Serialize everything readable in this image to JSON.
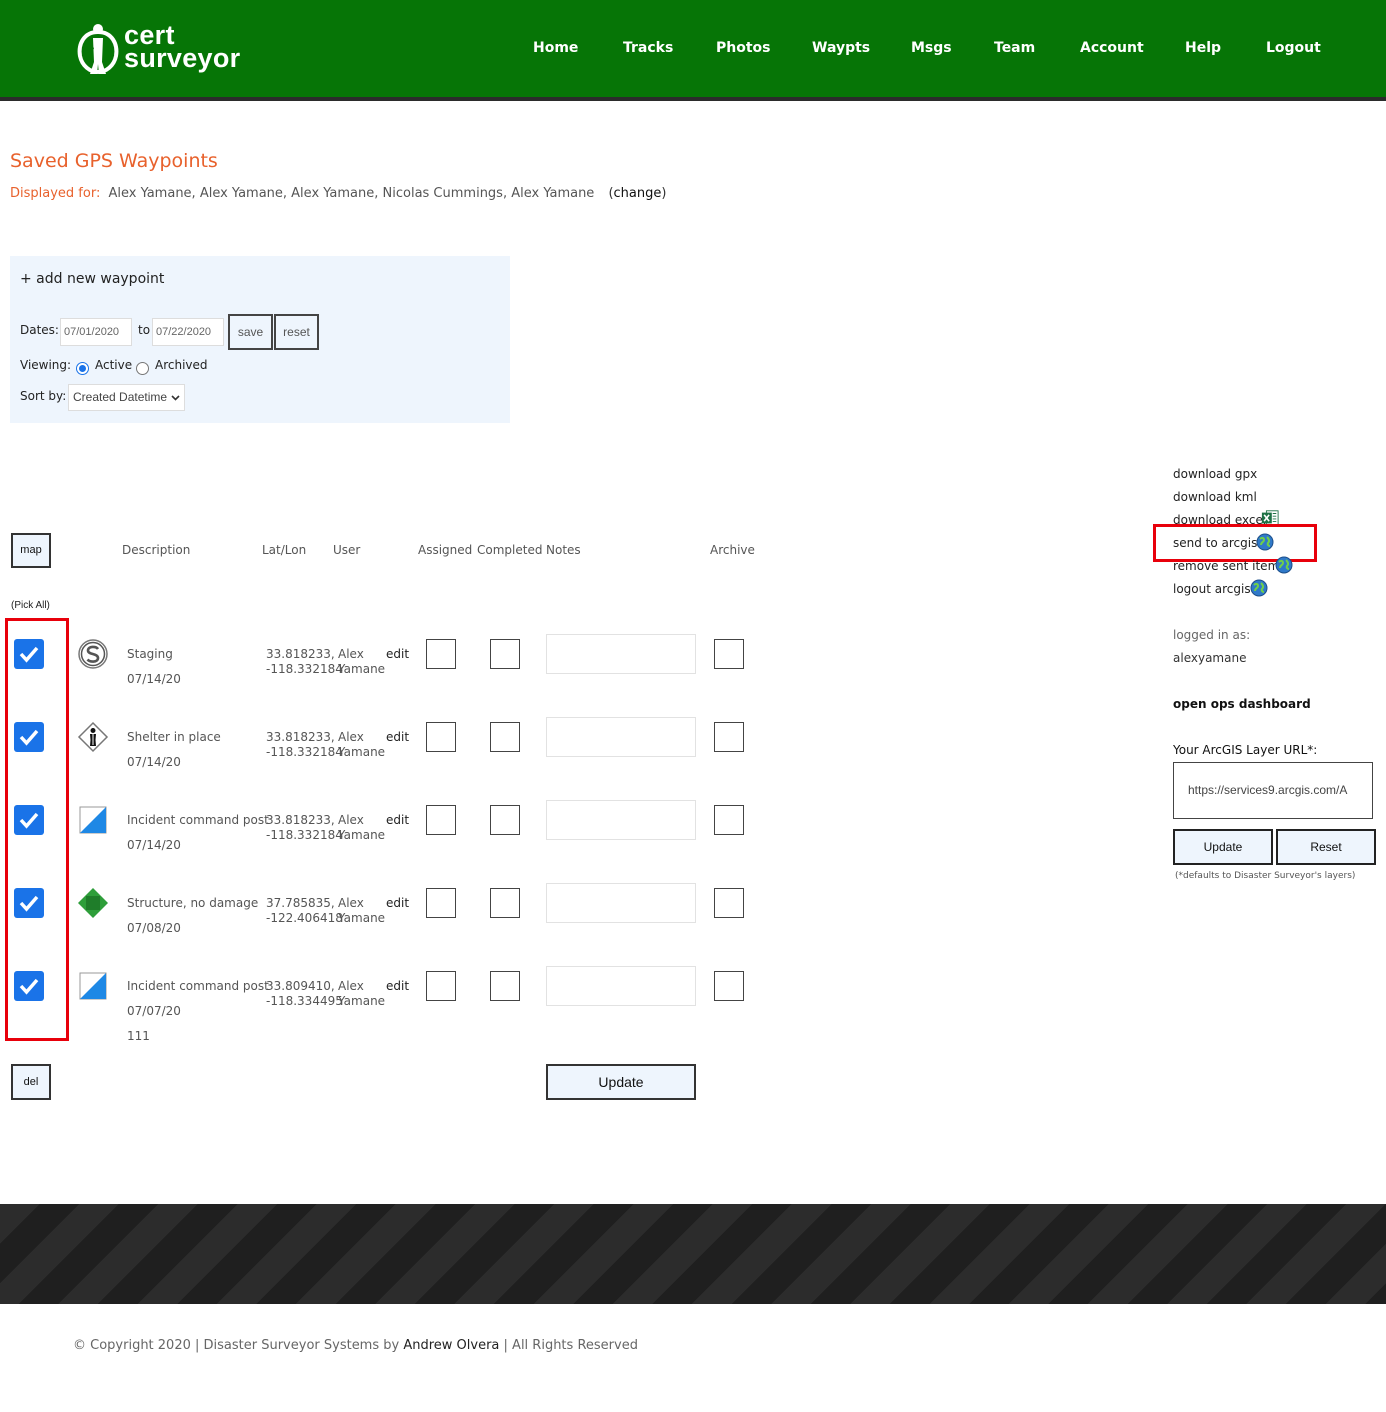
{
  "brand": {
    "line1": "cert",
    "line2": "surveyor"
  },
  "nav": [
    "Home",
    "Tracks",
    "Photos",
    "Waypts",
    "Msgs",
    "Team",
    "Account",
    "Help",
    "Logout"
  ],
  "page": {
    "title": "Saved GPS Waypoints",
    "displayed_for_label": "Displayed for:",
    "displayed_for_names": "Alex Yamane, Alex Yamane, Alex Yamane, Nicolas Cummings, Alex Yamane",
    "change_open": "(",
    "change_label": "change",
    "change_close": ")"
  },
  "filters": {
    "add_new": "+ add new waypoint",
    "dates_label": "Dates:",
    "date_from": "07/01/2020",
    "to_label": "to",
    "date_to": "07/22/2020",
    "save": "save",
    "reset": "reset",
    "viewing_label": "Viewing:",
    "active": "Active",
    "archived": "Archived",
    "viewing_selected": "Active",
    "sort_label": "Sort by:",
    "sort_value": "Created Datetime"
  },
  "table": {
    "map_button": "map",
    "headers": {
      "description": "Description",
      "latlon": "Lat/Lon",
      "user": "User",
      "assigned": "Assigned",
      "completed": "Completed",
      "notes": "Notes",
      "archive": "Archive"
    },
    "pick_all": "(Pick All)",
    "rows": [
      {
        "icon": "staging-s-icon",
        "description": "Staging",
        "date": "07/14/20",
        "extra": "",
        "lat": "33.818233,",
        "lon": "-118.332184",
        "user_first": "Alex",
        "user_last": "Yamane",
        "edit": "edit",
        "checked": true
      },
      {
        "icon": "shelter-in-place-icon",
        "description": "Shelter in place",
        "date": "07/14/20",
        "extra": "",
        "lat": "33.818233,",
        "lon": "-118.332184",
        "user_first": "Alex",
        "user_last": "Yamane",
        "edit": "edit",
        "checked": true
      },
      {
        "icon": "incident-command-post-icon",
        "description": "Incident command post",
        "date": "07/14/20",
        "extra": "",
        "lat": "33.818233,",
        "lon": "-118.332184",
        "user_first": "Alex",
        "user_last": "Yamane",
        "edit": "edit",
        "checked": true
      },
      {
        "icon": "structure-no-damage-icon",
        "description": "Structure, no damage",
        "date": "07/08/20",
        "extra": "",
        "lat": "37.785835,",
        "lon": "-122.406418",
        "user_first": "Alex",
        "user_last": "Yamane",
        "edit": "edit",
        "checked": true
      },
      {
        "icon": "incident-command-post-icon",
        "description": "Incident command post",
        "date": "07/07/20",
        "extra": "111",
        "lat": "33.809410,",
        "lon": "-118.334495",
        "user_first": "Alex",
        "user_last": "Yamane",
        "edit": "edit",
        "checked": true
      }
    ],
    "del_button": "del",
    "update_button": "Update"
  },
  "sidebar": {
    "download_gpx": "download gpx",
    "download_kml": "download kml",
    "download_excel": "download excel",
    "send_to_arcgis": "send to arcgis",
    "remove_sent_item": "remove sent item",
    "logout_arcgis": "logout arcgis",
    "logged_in_label": "logged in as:",
    "username": "alexyamane",
    "ops_dashboard": "open ops dashboard",
    "arcgis_url_label": "Your ArcGIS Layer URL*:",
    "arcgis_url_value": "https://services9.arcgis.com/A",
    "update": "Update",
    "reset": "Reset",
    "defaults_note": "(*defaults to Disaster Surveyor's layers)"
  },
  "footer": {
    "copyright_prefix": "© Copyright 2020 | Disaster Surveyor Systems by ",
    "author": "Andrew Olvera",
    "copyright_suffix": " | All Rights Reserved"
  },
  "colors": {
    "header_green": "#067506",
    "accent_orange": "#e8612c",
    "checkbox_blue": "#1a73e8",
    "highlight_red": "#e8000b",
    "panel_bg": "#eef5fd"
  }
}
